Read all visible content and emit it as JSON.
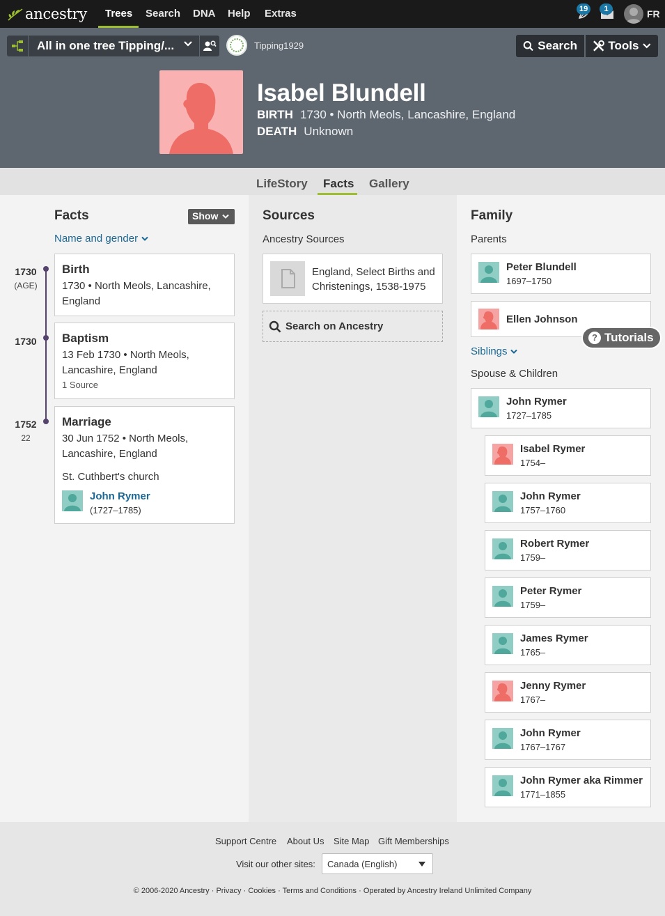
{
  "nav": {
    "brand": "ancestry",
    "links": [
      "Trees",
      "Search",
      "DNA",
      "Help",
      "Extras"
    ],
    "hints_count": "19",
    "messages_count": "1",
    "user_initials": "FR"
  },
  "header": {
    "tree_name": "All in one tree Tipping/...",
    "owner": "Tipping1929",
    "search_label": "Search",
    "tools_label": "Tools",
    "person": {
      "name": "Isabel Blundell",
      "birth_label": "BIRTH",
      "birth_value": "1730 • North Meols, Lancashire, England",
      "death_label": "DEATH",
      "death_value": "Unknown"
    }
  },
  "tabs": [
    "LifeStory",
    "Facts",
    "Gallery"
  ],
  "active_tab": "Facts",
  "facts": {
    "title": "Facts",
    "show_label": "Show",
    "name_gender_link": "Name and gender",
    "timeline": [
      {
        "year": "1730",
        "sub": "(AGE)"
      },
      {
        "year": "1730",
        "sub": ""
      },
      {
        "year": "1752",
        "sub": "22"
      }
    ],
    "items": [
      {
        "title": "Birth",
        "line1": "1730 • North Meols, Lancashire,",
        "line2": "England",
        "source": ""
      },
      {
        "title": "Baptism",
        "line1": "13 Feb 1730 • North Meols,",
        "line2": "Lancashire, England",
        "source": "1 Source"
      },
      {
        "title": "Marriage",
        "line1": "30 Jun 1752 • North Meols,",
        "line2": "Lancashire, England",
        "note": "St. Cuthbert's church",
        "spouse_name": "John Rymer",
        "spouse_dates": "(1727–1785)"
      }
    ]
  },
  "sources": {
    "title": "Sources",
    "subtitle": "Ancestry Sources",
    "items": [
      {
        "line1": "England, Select Births and",
        "line2": "Christenings, 1538-1975"
      }
    ],
    "search_label": "Search on Ancestry"
  },
  "family": {
    "title": "Family",
    "parents_label": "Parents",
    "parents": [
      {
        "name": "Peter Blundell",
        "dates": "1697–1750",
        "gender": "m"
      },
      {
        "name": "Ellen Johnson",
        "dates": "",
        "gender": "f"
      }
    ],
    "siblings_label": "Siblings",
    "spouse_children_label": "Spouse & Children",
    "spouse": {
      "name": "John Rymer",
      "dates": "1727–1785",
      "gender": "m"
    },
    "children": [
      {
        "name": "Isabel Rymer",
        "dates": "1754–",
        "gender": "f"
      },
      {
        "name": "John Rymer",
        "dates": "1757–1760",
        "gender": "m"
      },
      {
        "name": "Robert Rymer",
        "dates": "1759–",
        "gender": "m"
      },
      {
        "name": "Peter Rymer",
        "dates": "1759–",
        "gender": "m"
      },
      {
        "name": "James Rymer",
        "dates": "1765–",
        "gender": "m"
      },
      {
        "name": "Jenny Rymer",
        "dates": "1767–",
        "gender": "f"
      },
      {
        "name": "John Rymer",
        "dates": "1767–1767",
        "gender": "m"
      },
      {
        "name": "John Rymer aka Rimmer",
        "dates": "1771–1855",
        "gender": "m"
      }
    ]
  },
  "tutorials_label": "Tutorials",
  "footer": {
    "links": [
      "Support Centre",
      "About Us",
      "Site Map",
      "Gift Memberships"
    ],
    "visit_label": "Visit our other sites:",
    "site_selected": "Canada (English)",
    "legal": [
      "© 2006-2020 Ancestry",
      "Privacy",
      "Cookies",
      "Terms and Conditions",
      "Operated by Ancestry Ireland Unlimited Company"
    ]
  },
  "colors": {
    "nav_bg": "#1a1a1a",
    "header_bg": "#5e6670",
    "accent_green": "#9cbe30",
    "link_blue": "#1b6894",
    "female": "#f6a3a3",
    "male": "#8fcdc5",
    "timeline": "#55436e"
  }
}
